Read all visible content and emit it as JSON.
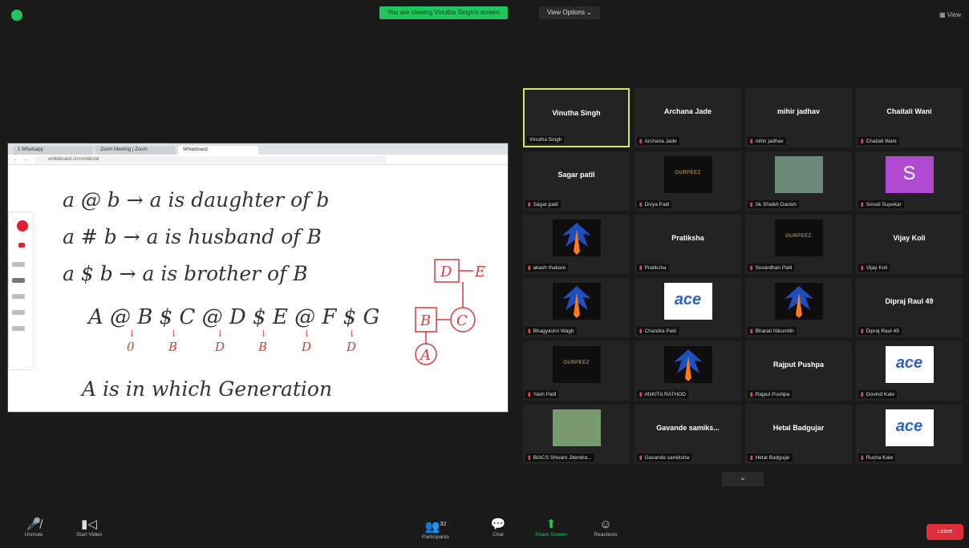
{
  "topbar": {
    "share_banner": "You are viewing Vinutha Singh's screen",
    "view_options": "View Options ⌄",
    "view_button": "View"
  },
  "browser": {
    "tabs": [
      "1 Whatsapp",
      "Zoom Meeting | Zoom",
      "Whiteboard"
    ],
    "url": "whiteboard.chromebook"
  },
  "whiteboard": {
    "lines": [
      "a @ b → a is daughter of b",
      "a # b → a is husband of B",
      "a $ b → a is brother of B",
      "A @ B $ C @ D $ E @ F $ G",
      "A is in which Generation"
    ],
    "generations": [
      "0",
      "B",
      "D",
      "B",
      "D",
      "D"
    ],
    "tree_nodes": [
      "D",
      "E",
      "B",
      "C",
      "A"
    ]
  },
  "gallery": [
    {
      "name": "Vinutha Singh",
      "label": "Vinutha Singh",
      "muted": false,
      "avatar": "none",
      "active": true
    },
    {
      "name": "Archana Jade",
      "label": "Archana Jade",
      "muted": true,
      "avatar": "none"
    },
    {
      "name": "mihir jadhav",
      "label": "mihir jadhav",
      "muted": true,
      "avatar": "none"
    },
    {
      "name": "Chaitali Wani",
      "label": "Chaitali Wani",
      "muted": true,
      "avatar": "none"
    },
    {
      "name": "Sagar patil",
      "label": "Sagar patil",
      "muted": true,
      "avatar": "none"
    },
    {
      "name": "",
      "label": "Divya Patil",
      "muted": true,
      "avatar": "logo"
    },
    {
      "name": "",
      "label": "Sk Shaikh Danish",
      "muted": true,
      "avatar": "photo"
    },
    {
      "name": "",
      "label": "Sonali Supekar",
      "muted": true,
      "avatar": "s"
    },
    {
      "name": "",
      "label": "akash thakare",
      "muted": true,
      "avatar": "eagle"
    },
    {
      "name": "Pratiksha",
      "label": "Pratiksha",
      "muted": true,
      "avatar": "none"
    },
    {
      "name": "",
      "label": "Suvardhan Patil",
      "muted": true,
      "avatar": "logo"
    },
    {
      "name": "Vijay Koli",
      "label": "Vijay Koli",
      "muted": true,
      "avatar": "none"
    },
    {
      "name": "",
      "label": "Bhagyashri Wagh",
      "muted": true,
      "avatar": "eagle"
    },
    {
      "name": "",
      "label": "Chandra Patil",
      "muted": true,
      "avatar": "ace"
    },
    {
      "name": "",
      "label": "Bharati Nikumbh",
      "muted": true,
      "avatar": "eagle"
    },
    {
      "name": "Dipraj Raul 49",
      "label": "Dipraj Raul 49",
      "muted": true,
      "avatar": "none"
    },
    {
      "name": "",
      "label": "Yash Patil",
      "muted": true,
      "avatar": "logo"
    },
    {
      "name": "",
      "label": "ANKITA RATHOD",
      "muted": true,
      "avatar": "eagle"
    },
    {
      "name": "Rajput Pushpa",
      "label": "Rajput Pushpa",
      "muted": true,
      "avatar": "none"
    },
    {
      "name": "",
      "label": "Govind Kale",
      "muted": true,
      "avatar": "ace"
    },
    {
      "name": "",
      "label": "BIACS Shivani Jitendra...",
      "muted": true,
      "avatar": "photo2"
    },
    {
      "name": "Gavande samiks...",
      "label": "Gavande samiksha",
      "muted": true,
      "avatar": "none"
    },
    {
      "name": "Hetal Badgujar",
      "label": "Hetal Badgujar",
      "muted": true,
      "avatar": "none"
    },
    {
      "name": "",
      "label": "Rucha Kale",
      "muted": true,
      "avatar": "ace"
    }
  ],
  "avatar_text": {
    "logo": "OURPEEZ",
    "s": "S",
    "ace": "ace"
  },
  "toolbar": {
    "unmute": "Unmute",
    "start_video": "Start Video",
    "participants": "Participants",
    "participants_count": "32",
    "chat": "Chat",
    "share_screen": "Share Screen",
    "reactions": "Reactions",
    "leave": "Leave"
  },
  "colors": {
    "accent_green": "#22c55e",
    "leave_red": "#e02f3a",
    "active_speaker": "#d9e85a",
    "ink_red": "#d93b3b"
  }
}
